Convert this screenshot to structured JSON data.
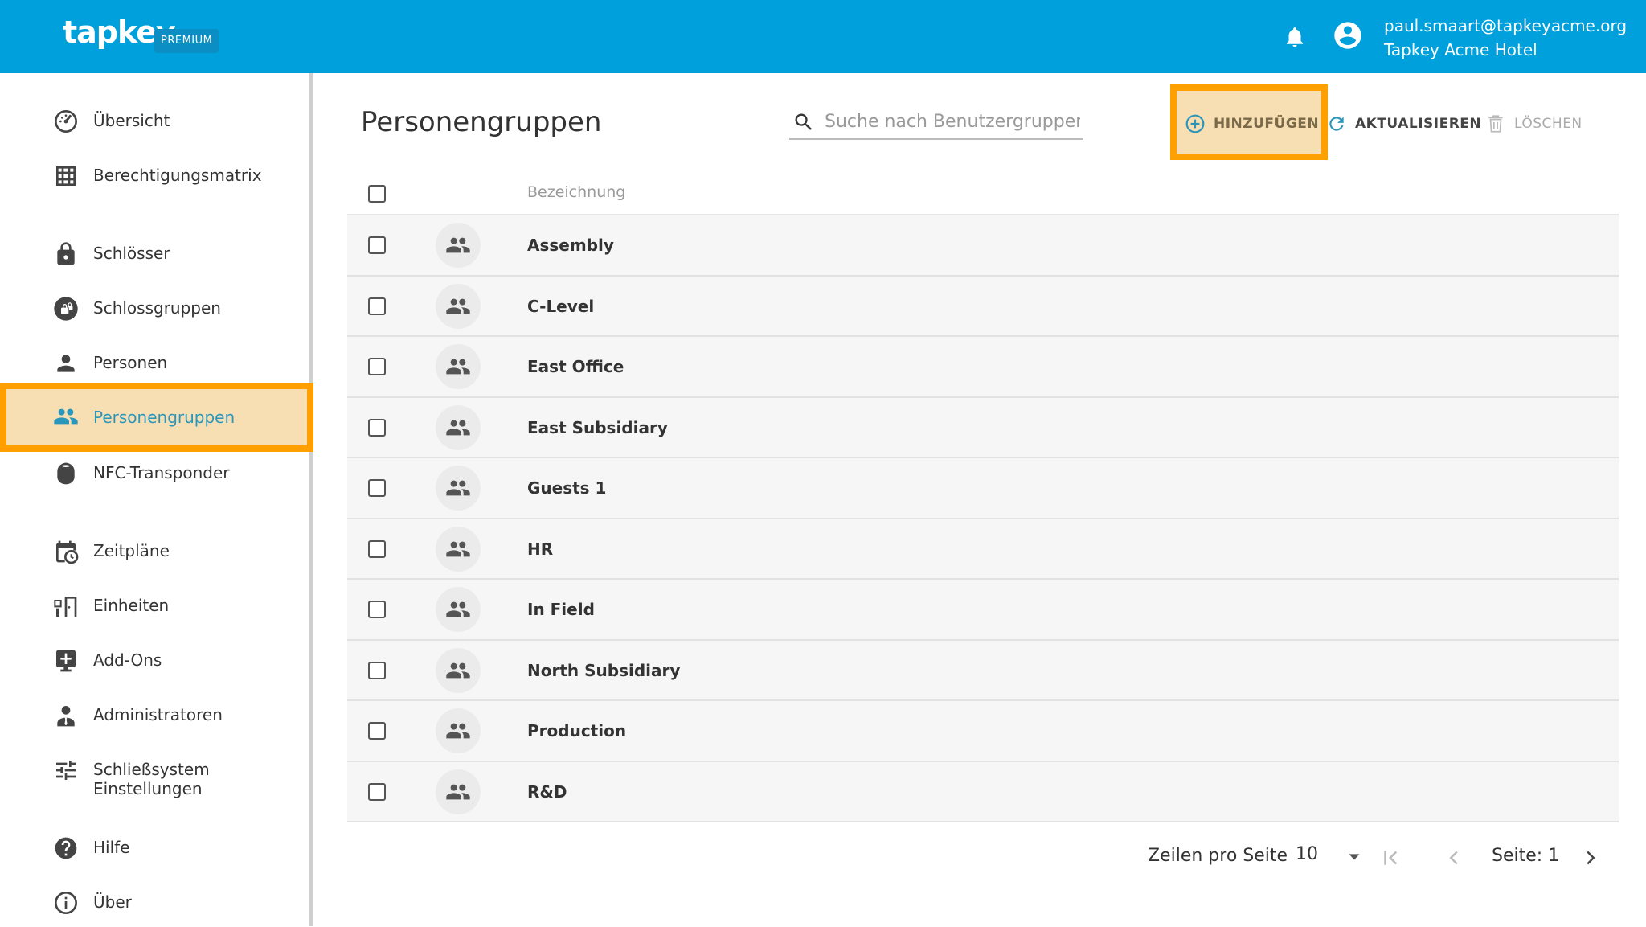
{
  "header": {
    "logo": "tapkey",
    "badge": "PREMIUM",
    "user_email": "paul.smaart@tapkeyacme.org",
    "user_org": "Tapkey Acme Hotel",
    "color": "#00a0dc"
  },
  "sidebar": {
    "items": [
      {
        "label": "Übersicht",
        "icon": "dashboard-icon"
      },
      {
        "label": "Berechtigungsmatrix",
        "icon": "grid-icon"
      },
      {
        "label": "Schlösser",
        "icon": "lock-icon"
      },
      {
        "label": "Schlossgruppen",
        "icon": "lock-group-icon"
      },
      {
        "label": "Personen",
        "icon": "person-icon"
      },
      {
        "label": "Personengruppen",
        "icon": "people-icon",
        "active": true
      },
      {
        "label": "NFC-Transponder",
        "icon": "transponder-icon"
      },
      {
        "label": "Zeitpläne",
        "icon": "calendar-clock-icon"
      },
      {
        "label": "Einheiten",
        "icon": "door-unit-icon"
      },
      {
        "label": "Add-Ons",
        "icon": "add-on-icon"
      },
      {
        "label": "Administratoren",
        "icon": "admin-icon"
      },
      {
        "label": "Schließsystem Einstellungen",
        "icon": "sliders-icon"
      },
      {
        "label": "Hilfe",
        "icon": "help-icon"
      },
      {
        "label": "Über",
        "icon": "info-icon"
      }
    ]
  },
  "main": {
    "title": "Personengruppen",
    "search_placeholder": "Suche nach Benutzergruppen",
    "toolbar": {
      "add_label": "HINZUFÜGEN",
      "refresh_label": "AKTUALISIEREN",
      "delete_label": "LÖSCHEN"
    },
    "table": {
      "column_header": "Bezeichnung",
      "rows": [
        "Assembly",
        "C-Level",
        "East Office",
        "East Subsidiary",
        "Guests 1",
        "HR",
        "In Field",
        "North Subsidiary",
        "Production",
        "R&D"
      ]
    },
    "pagination": {
      "rows_per_page_label": "Zeilen pro Seite",
      "rows_per_page_value": "10",
      "page_label": "Seite: 1"
    }
  },
  "highlight_color": "#ffa000"
}
